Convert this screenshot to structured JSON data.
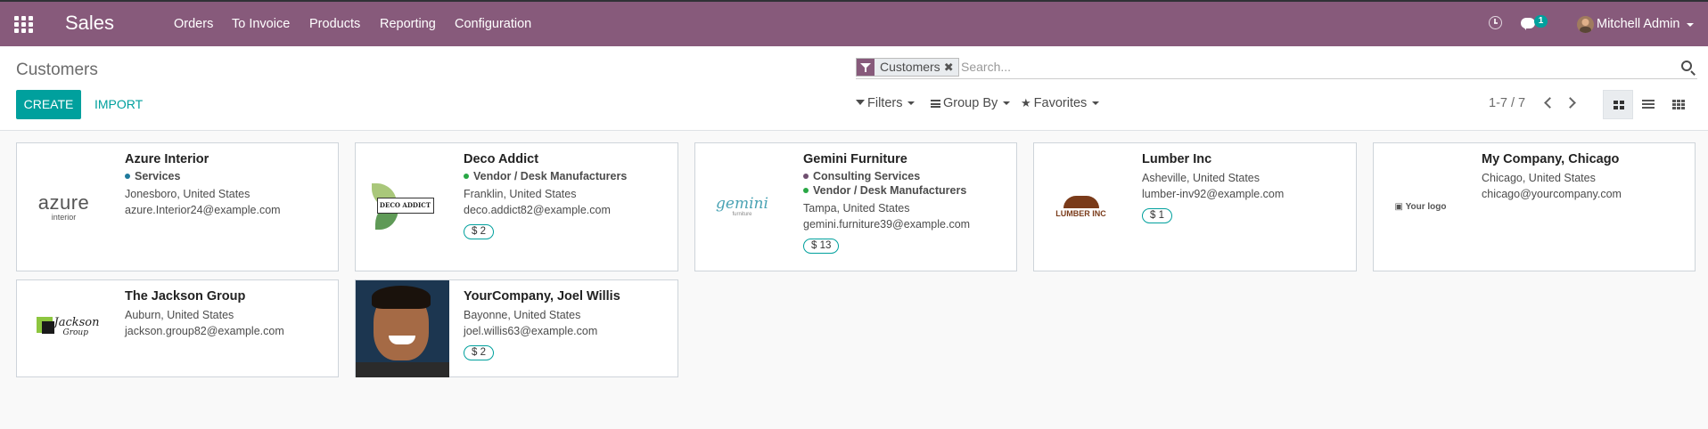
{
  "navbar": {
    "app_name": "Sales",
    "menu": [
      "Orders",
      "To Invoice",
      "Products",
      "Reporting",
      "Configuration"
    ],
    "chat_count": "1",
    "user_name": "Mitchell Admin",
    "icons": [
      "apps-icon",
      "clock-icon",
      "chat-icon"
    ],
    "color": "#875a7b"
  },
  "control": {
    "title": "Customers",
    "create_label": "CREATE",
    "import_label": "IMPORT",
    "facet_label": "Customers",
    "search_placeholder": "Search...",
    "filters_label": "Filters",
    "groupby_label": "Group By",
    "favorites_label": "Favorites",
    "pager": "1-7 / 7",
    "accent": "#00a09d"
  },
  "cards": [
    {
      "name": "Azure Interior",
      "tags": [
        {
          "label": "Services",
          "color": "#1f7a9c"
        }
      ],
      "location": "Jonesboro, United States",
      "email": "azure.Interior24@example.com",
      "badge": "",
      "logo": "azure-logo",
      "logo_text": "azure",
      "logo_sub": "interior"
    },
    {
      "name": "Deco Addict",
      "tags": [
        {
          "label": "Vendor / Desk Manufacturers",
          "color": "#28a745"
        }
      ],
      "location": "Franklin, United States",
      "email": "deco.addict82@example.com",
      "badge": "$ 2",
      "logo": "deco-addict-logo",
      "logo_text": "DECO ADDICT"
    },
    {
      "name": "Gemini Furniture",
      "tags": [
        {
          "label": "Consulting Services",
          "color": "#6f4e6f"
        },
        {
          "label": "Vendor / Desk Manufacturers",
          "color": "#28a745"
        }
      ],
      "location": "Tampa, United States",
      "email": "gemini.furniture39@example.com",
      "badge": "$ 13",
      "logo": "gemini-logo",
      "logo_text": "gemini",
      "logo_sub": "furniture"
    },
    {
      "name": "Lumber Inc",
      "tags": [],
      "location": "Asheville, United States",
      "email": "lumber-inv92@example.com",
      "badge": "$ 1",
      "logo": "lumber-logo",
      "logo_text": "LUMBER INC"
    },
    {
      "name": "My Company, Chicago",
      "tags": [],
      "location": "Chicago, United States",
      "email": "chicago@yourcompany.com",
      "badge": "",
      "logo": "your-logo",
      "logo_text": "Your logo"
    },
    {
      "name": "The Jackson Group",
      "tags": [],
      "location": "Auburn, United States",
      "email": "jackson.group82@example.com",
      "badge": "",
      "logo": "jackson-logo",
      "logo_text": "Jackson",
      "logo_sub": "Group"
    },
    {
      "name": "YourCompany, Joel Willis",
      "tags": [],
      "location": "Bayonne, United States",
      "email": "joel.willis63@example.com",
      "badge": "$ 2",
      "logo": "photo"
    }
  ]
}
